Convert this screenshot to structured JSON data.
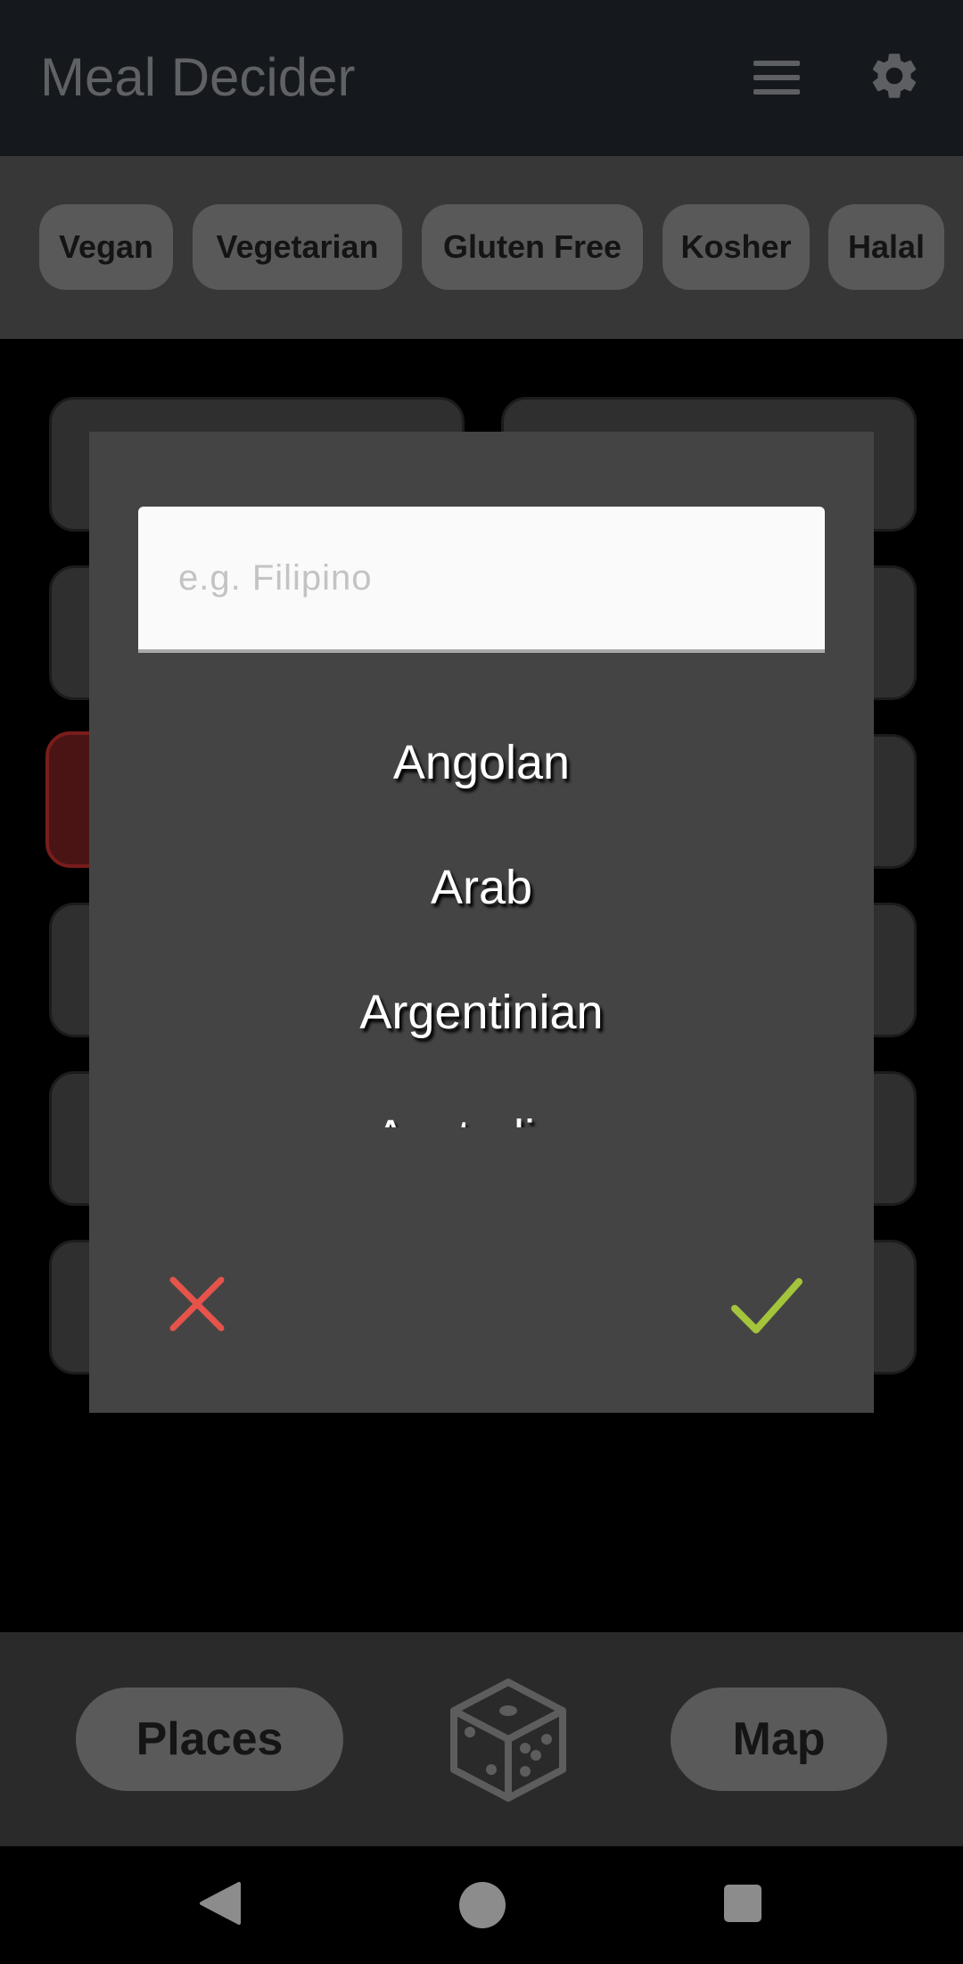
{
  "app": {
    "title": "Meal Decider"
  },
  "toolbar": {
    "menu_icon": "hamburger-menu-icon",
    "settings_icon": "gear-icon"
  },
  "filters": [
    {
      "label": "Vegan"
    },
    {
      "label": "Vegetarian"
    },
    {
      "label": "Gluten Free"
    },
    {
      "label": "Kosher"
    },
    {
      "label": "Halal"
    }
  ],
  "dialog": {
    "search_placeholder": "e.g. Filipino",
    "options": [
      {
        "label": "Angolan"
      },
      {
        "label": "Arab"
      },
      {
        "label": "Argentinian"
      },
      {
        "label": "Australian"
      }
    ],
    "cancel_icon": "close-icon",
    "confirm_icon": "check-icon",
    "colors": {
      "cancel": "#e5534b",
      "confirm": "#a3c43b"
    }
  },
  "bottom": {
    "places_label": "Places",
    "map_label": "Map",
    "dice_icon": "dice-icon"
  }
}
